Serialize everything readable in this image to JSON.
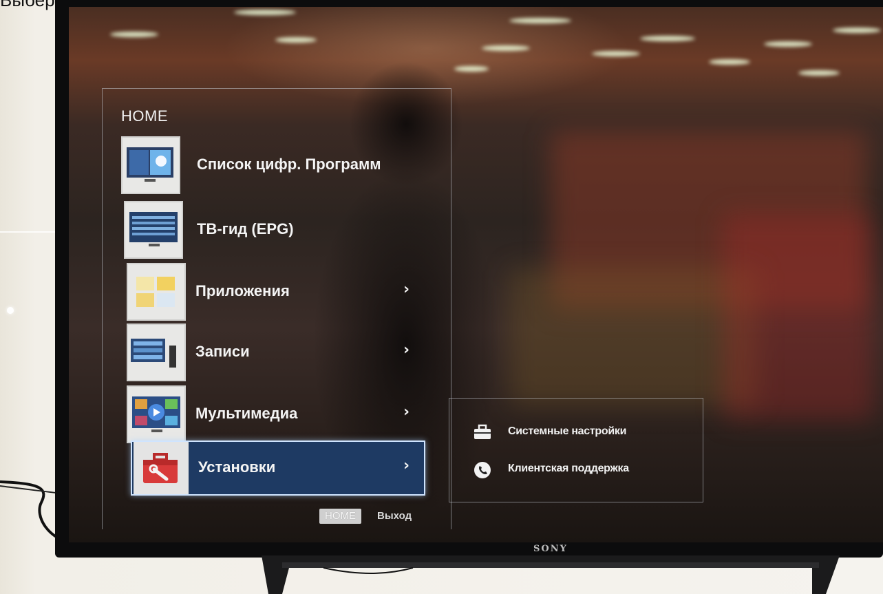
{
  "caption": "Выберите пункт меню «Установки».",
  "tv": {
    "brand": "SONY"
  },
  "home_menu": {
    "title": "HOME",
    "items": [
      {
        "label": "Список цифр. Программ",
        "has_submenu": false,
        "icon": "digital-channel-list-icon"
      },
      {
        "label": "ТВ-гид (EPG)",
        "has_submenu": false,
        "icon": "tv-guide-icon"
      },
      {
        "label": "Приложения",
        "has_submenu": true,
        "chevron": "›",
        "icon": "applications-icon"
      },
      {
        "label": "Записи",
        "has_submenu": true,
        "chevron": "›",
        "icon": "recordings-icon"
      },
      {
        "label": "Мультимедиа",
        "has_submenu": true,
        "chevron": "›",
        "icon": "multimedia-icon"
      },
      {
        "label": "Установки",
        "has_submenu": true,
        "chevron": "›",
        "icon": "settings-toolbox-icon",
        "selected": true
      }
    ]
  },
  "submenu": {
    "items": [
      {
        "label": "Системные настройки",
        "icon": "toolbox-icon"
      },
      {
        "label": "Клиентская поддержка",
        "icon": "phone-icon"
      }
    ]
  },
  "footer": {
    "home_key": "HOME",
    "exit_label": "Выход"
  },
  "colors": {
    "selection_bg": "#1e3a63",
    "selection_border": "#cfe4ff",
    "text": "#f4f4f4"
  }
}
